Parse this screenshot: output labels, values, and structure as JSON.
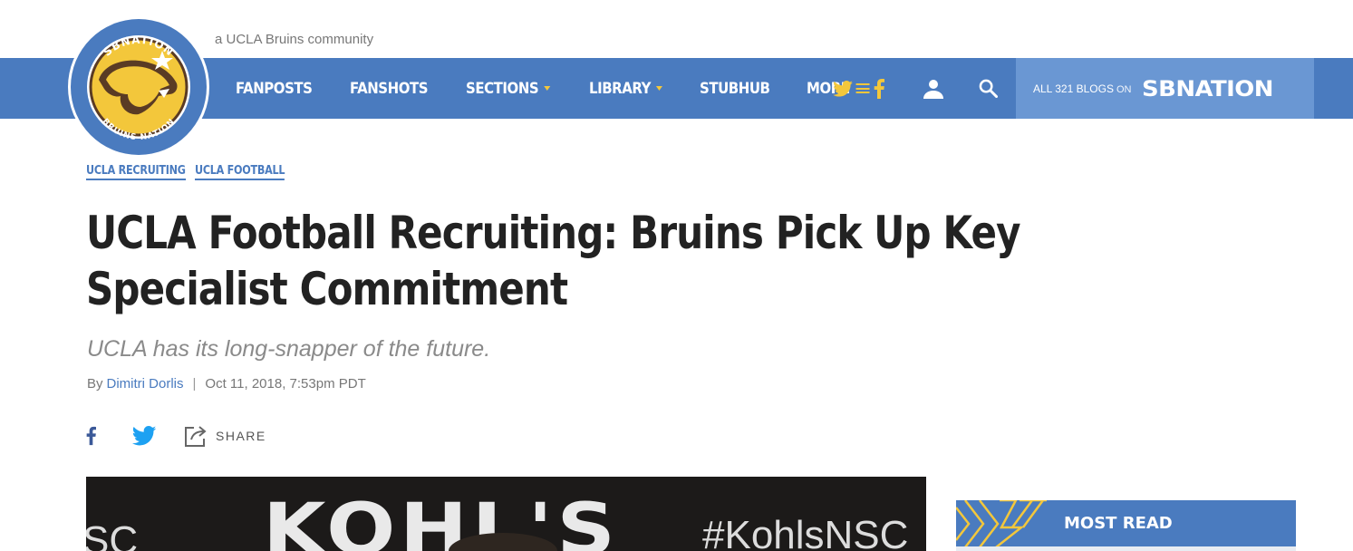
{
  "site": {
    "tagline": "a UCLA Bruins community",
    "logo_text_top": "SBNATION",
    "logo_text_bottom": "BRUINS NATION"
  },
  "nav": {
    "links": [
      {
        "label": "FANPOSTS"
      },
      {
        "label": "FANSHOTS"
      },
      {
        "label": "SECTIONS"
      },
      {
        "label": "LIBRARY"
      },
      {
        "label": "STUBHUB"
      },
      {
        "label": "MORE"
      }
    ],
    "icons": [
      "twitter-icon",
      "facebook-icon",
      "user-icon",
      "search-icon"
    ],
    "sbn_all_blogs": "ALL 321 BLOGS",
    "sbn_on": "ON",
    "sbn_brand": "SBNATION"
  },
  "article": {
    "categories": [
      "UCLA RECRUITING",
      "UCLA FOOTBALL"
    ],
    "headline": "UCLA Football Recruiting: Bruins Pick Up Key Specialist Commitment",
    "dek": "UCLA has its long-snapper of the future.",
    "by": "By",
    "author": "Dimitri Dorlis",
    "separator": "|",
    "timestamp": "Oct 11, 2018, 7:53pm PDT",
    "share_label": "SHARE"
  },
  "hero": {
    "sign_text": "KOHL'S",
    "hashtag": "#KohlsNSC",
    "left_text": "SC"
  },
  "sidebar": {
    "most_read_title": "MOST READ"
  },
  "colors": {
    "brand_blue": "#4a7bbf",
    "brand_gold": "#f3c73b",
    "sbn_box": "#6a97d3",
    "headline": "#222222"
  }
}
